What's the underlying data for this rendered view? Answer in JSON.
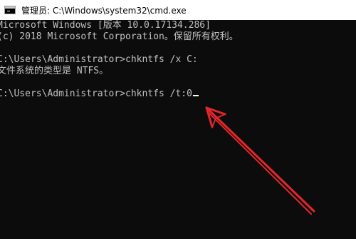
{
  "window": {
    "title": "管理员: C:\\Windows\\system32\\cmd.exe",
    "icon": "cmd-icon"
  },
  "console": {
    "lines": [
      "Microsoft Windows [版本 10.0.17134.286]",
      "(c) 2018 Microsoft Corporation。保留所有权利。",
      "",
      "C:\\Users\\Administrator>chkntfs /x C:",
      "文件系统的类型是 NTFS。",
      "",
      "C:\\Users\\Administrator>chkntfs /t:0"
    ]
  },
  "annotation": {
    "icon": "red-arrow-icon",
    "color": "#e3262b"
  }
}
